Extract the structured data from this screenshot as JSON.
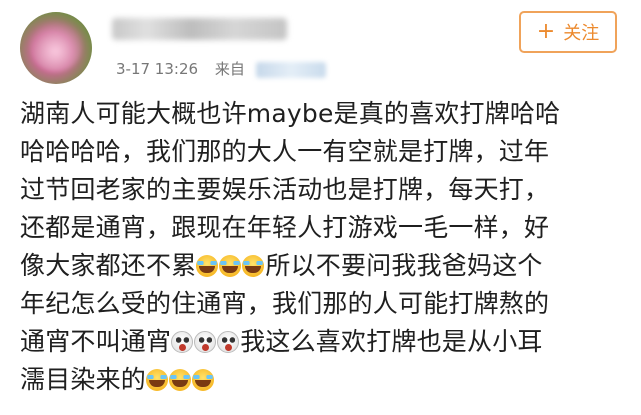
{
  "post": {
    "timestamp": "3-17 13:26",
    "source_prefix": "来自",
    "follow_label": "关注",
    "follow_icon": "plus-icon",
    "lines": [
      {
        "text": "湖南人可能大概也许maybe是真的喜欢打牌哈哈"
      },
      {
        "text": "哈哈哈哈，我们那的大人一有空就是打牌，过年"
      },
      {
        "text": "过节回老家的主要娱乐活动也是打牌，每天打，"
      },
      {
        "text": "还都是通宵，跟现在年轻人打游戏一毛一样，好"
      },
      {
        "text_before": "像大家都还不累",
        "emoji": "laugh",
        "emoji_count": 3,
        "text_after": "所以不要问我我爸妈这个"
      },
      {
        "text": "年纪怎么受的住通宵，我们那的人可能打牌熬的"
      },
      {
        "text_before": "通宵不叫通宵",
        "emoji": "shock",
        "emoji_count": 3,
        "text_after": "我这么喜欢打牌也是从小耳"
      },
      {
        "text_before": "濡目染来的",
        "emoji": "laugh",
        "emoji_count": 3,
        "text_after": ""
      }
    ]
  }
}
